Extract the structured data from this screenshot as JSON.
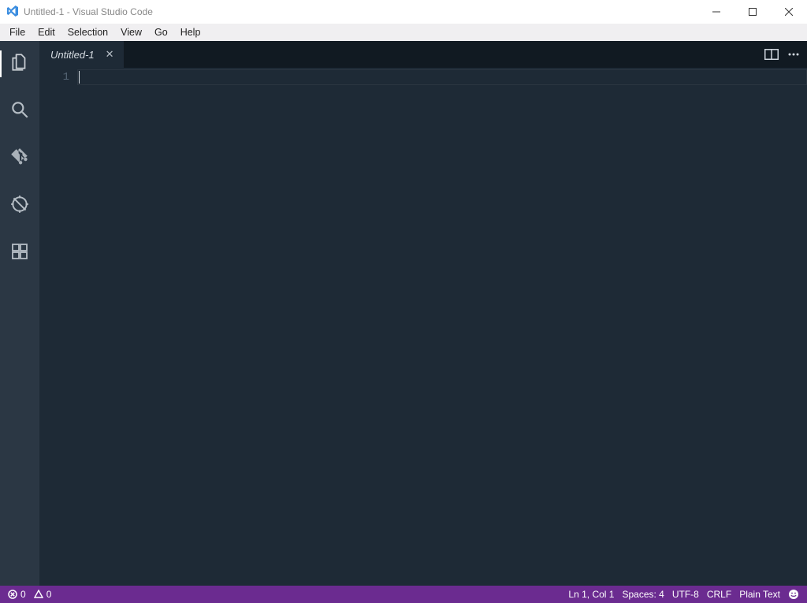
{
  "title": "Untitled-1 - Visual Studio Code",
  "menu": [
    "File",
    "Edit",
    "Selection",
    "View",
    "Go",
    "Help"
  ],
  "tab": {
    "name": "Untitled-1"
  },
  "editor": {
    "lineNumber": "1"
  },
  "status": {
    "errors": "0",
    "warnings": "0",
    "lineCol": "Ln 1, Col 1",
    "spaces": "Spaces: 4",
    "encoding": "UTF-8",
    "eol": "CRLF",
    "language": "Plain Text"
  }
}
